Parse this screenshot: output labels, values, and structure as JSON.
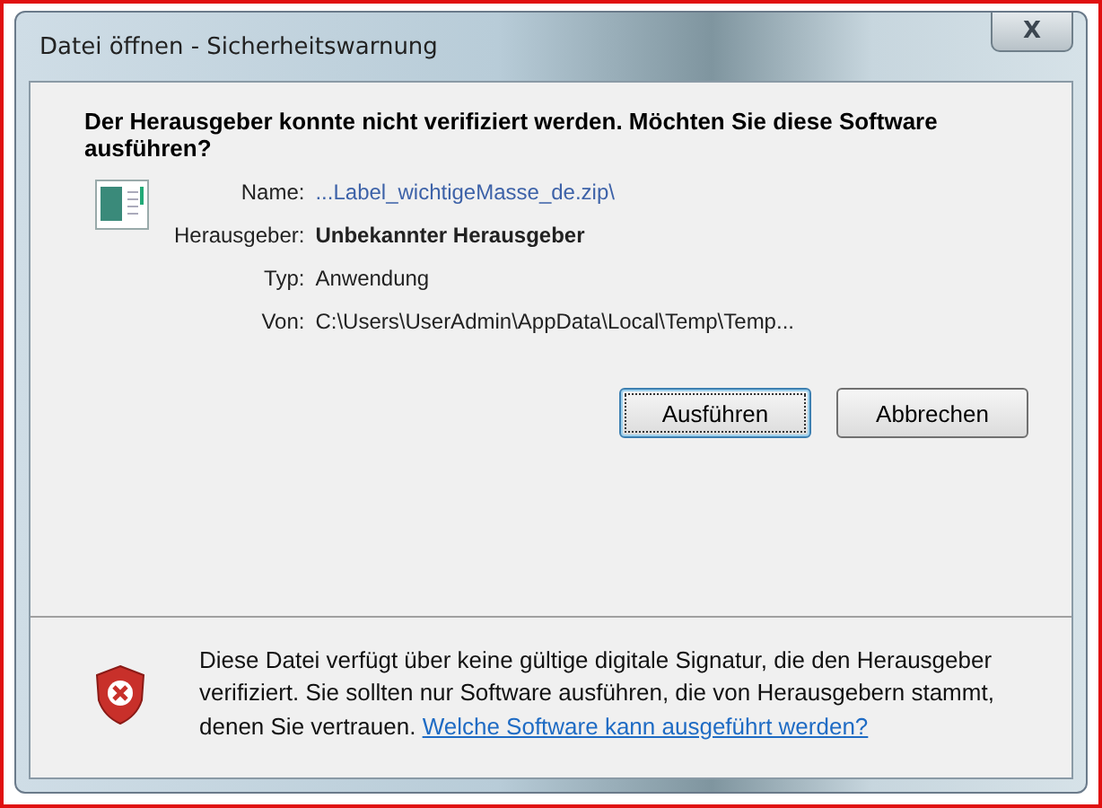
{
  "window": {
    "title": "Datei öffnen - Sicherheitswarnung",
    "close": "X"
  },
  "heading": "Der Herausgeber konnte nicht verifiziert werden. Möchten Sie diese Software ausführen?",
  "details": [
    {
      "label": "Name:",
      "value": "...Label_wichtigeMasse_de.zip\\",
      "kind": "link"
    },
    {
      "label": "Herausgeber:",
      "value": "Unbekannter Herausgeber",
      "kind": "bold"
    },
    {
      "label": "Typ:",
      "value": "Anwendung",
      "kind": "plain"
    },
    {
      "label": "Von:",
      "value": "C:\\Users\\UserAdmin\\AppData\\Local\\Temp\\Temp...",
      "kind": "plain"
    }
  ],
  "buttons": [
    {
      "label": "Ausführen",
      "selected": true
    },
    {
      "label": "Abbrechen",
      "selected": false
    }
  ],
  "warning": {
    "text": "Diese Datei verfügt über keine gültige digitale Signatur, die den Herausgeber verifiziert. Sie sollten nur Software ausführen, die von Herausgebern stammt, denen Sie vertrauen.",
    "link": "Welche Software kann ausgeführt werden?"
  }
}
